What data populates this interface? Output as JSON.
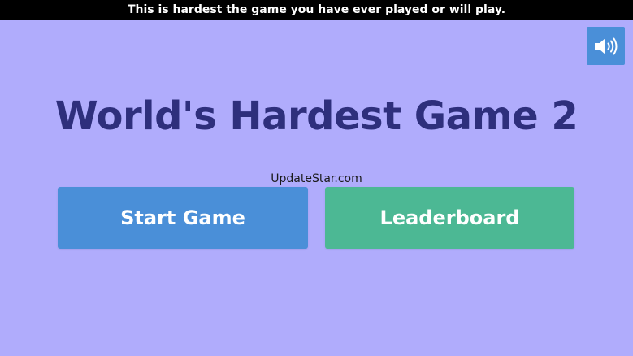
{
  "banner": {
    "text": "This is hardest the game you have ever played or will play."
  },
  "sound": {
    "icon": "speaker-volume-icon"
  },
  "title": "World's Hardest Game 2",
  "watermark": "UpdateStar.com",
  "menu": {
    "start_label": "Start Game",
    "leaderboard_label": "Leaderboard"
  },
  "colors": {
    "background": "#b0acfc",
    "title": "#2e2f7c",
    "start_button": "#4a8fd8",
    "leaderboard_button": "#4cb894",
    "sound_button": "#4a8fd8",
    "banner": "#000000"
  }
}
